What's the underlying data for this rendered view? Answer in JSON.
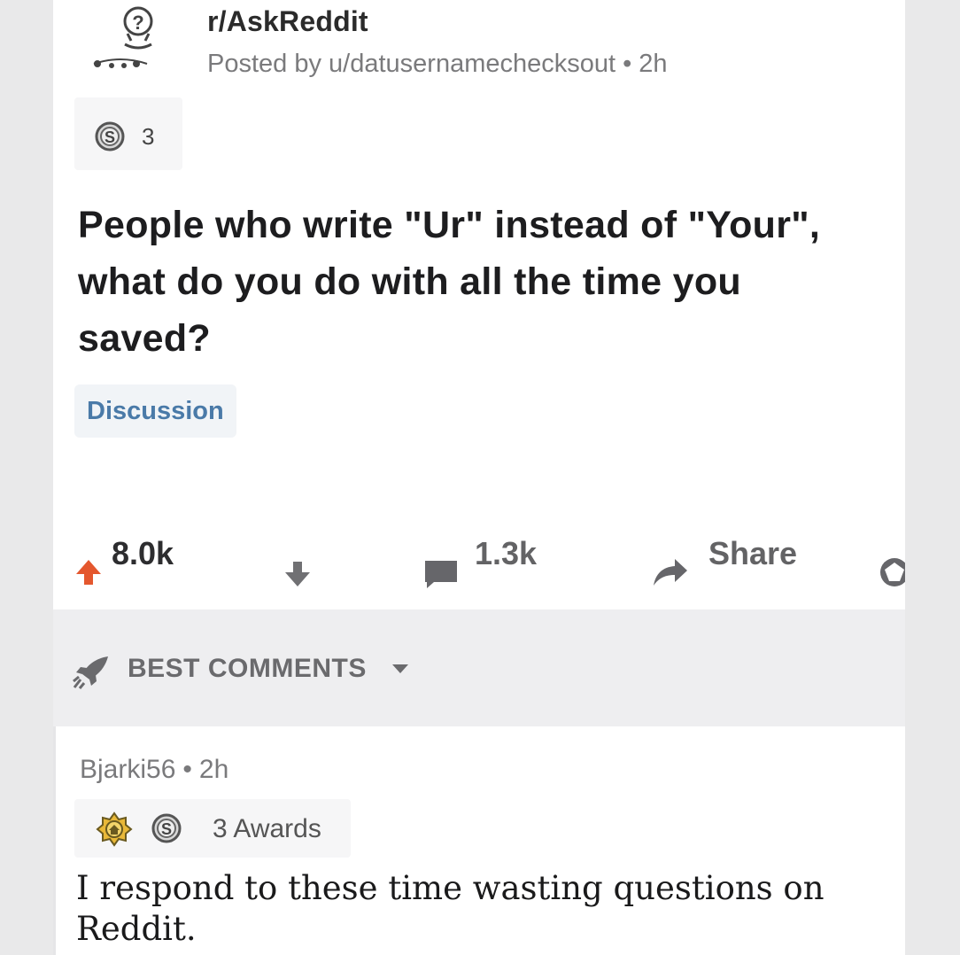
{
  "post": {
    "subreddit": "r/AskReddit",
    "posted_by_prefix": "Posted by",
    "author": "u/datusernamechecksout",
    "separator": "•",
    "age": "2h",
    "award_count": "3",
    "title": "People who write \"Ur\" instead of \"Your\", what do you do with all the time you saved?",
    "flair": "Discussion"
  },
  "actions": {
    "score": "8.0k",
    "comments": "1.3k",
    "share_label": "Share"
  },
  "comments_sort": {
    "label": "BEST COMMENTS"
  },
  "comment": {
    "author": "Bjarki56",
    "separator": "•",
    "age": "2h",
    "awards_label": "3 Awards",
    "body": "I respond to these time wasting questions on Reddit."
  },
  "icons": {
    "subreddit": "question-mark-snoo-icon",
    "award": "silver-award-icon",
    "upvote": "upvote-arrow-icon",
    "downvote": "downvote-arrow-icon",
    "comment": "comment-bubble-icon",
    "share": "share-arrow-icon",
    "save": "gem-icon",
    "sort": "rocket-icon",
    "caret": "caret-down-icon",
    "helpful_award": "helpful-award-icon"
  },
  "colors": {
    "upvote_active": "#e4572e",
    "flair_text": "#4a7aa8",
    "muted_text": "#7a7a7c"
  }
}
